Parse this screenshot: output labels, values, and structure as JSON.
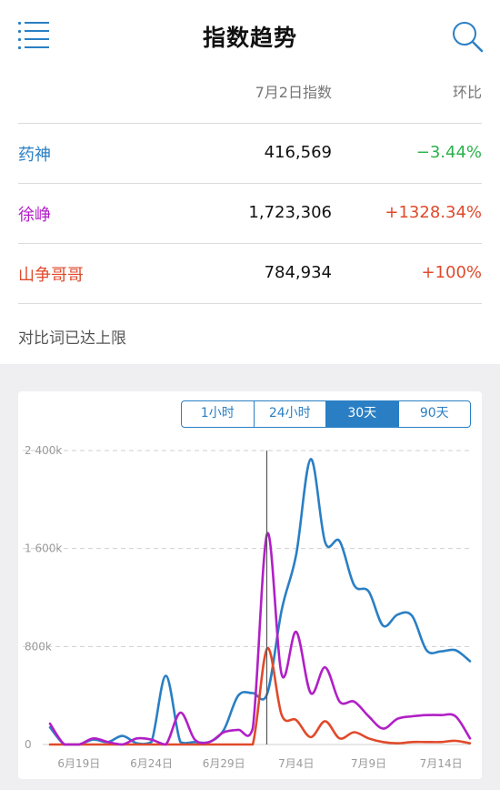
{
  "header": {
    "title": "指数趋势"
  },
  "table": {
    "col_date": "7月2日指数",
    "col_change": "环比",
    "rows": [
      {
        "name": "药神",
        "value": "416,569",
        "change": "−3.44%",
        "name_color": "#2a7fc4",
        "change_color": "#2bb24c"
      },
      {
        "name": "徐峥",
        "value": "1,723,306",
        "change": "+1328.34%",
        "name_color": "#b11fc6",
        "change_color": "#e04a2b"
      },
      {
        "name": "山争哥哥",
        "value": "784,934",
        "change": "+100%",
        "name_color": "#e04a2b",
        "change_color": "#e04a2b"
      }
    ]
  },
  "limit_note": "对比词已达上限",
  "range_tabs": {
    "options": [
      "1小时",
      "24小时",
      "30天",
      "90天"
    ],
    "selected": "30天"
  },
  "chart_data": {
    "type": "line",
    "x": [
      "6月17日",
      "6月18日",
      "6月19日",
      "6月20日",
      "6月21日",
      "6月22日",
      "6月23日",
      "6月24日",
      "6月25日",
      "6月26日",
      "6月27日",
      "6月28日",
      "6月29日",
      "6月30日",
      "7月1日",
      "7月2日",
      "7月3日",
      "7月4日",
      "7月5日",
      "7月6日",
      "7月7日",
      "7月8日",
      "7月9日",
      "7月10日",
      "7月11日",
      "7月12日",
      "7月13日",
      "7月14日",
      "7月15日",
      "7月16日"
    ],
    "x_ticks": [
      "6月19日",
      "6月24日",
      "6月29日",
      "7月4日",
      "7月9日",
      "7月14日"
    ],
    "y_ticks": [
      "0",
      "800k",
      "1 600k",
      "2 400k"
    ],
    "ylim": [
      0,
      2400000
    ],
    "grid": true,
    "marker_x": "7月2日",
    "series": [
      {
        "color": "#2a7fc4",
        "values": [
          140000,
          0,
          0,
          40000,
          20000,
          70000,
          10000,
          20000,
          560000,
          20000,
          20000,
          20000,
          120000,
          400000,
          420000,
          416569,
          1100000,
          1550000,
          2330000,
          1650000,
          1660000,
          1300000,
          1250000,
          970000,
          1060000,
          1050000,
          770000,
          760000,
          770000,
          680000
        ]
      },
      {
        "color": "#b11fc6",
        "values": [
          170000,
          0,
          0,
          50000,
          20000,
          0,
          50000,
          40000,
          0,
          260000,
          40000,
          20000,
          100000,
          120000,
          130000,
          1723306,
          570000,
          920000,
          420000,
          630000,
          350000,
          350000,
          230000,
          130000,
          210000,
          230000,
          240000,
          240000,
          230000,
          50000
        ]
      },
      {
        "color": "#e04a2b",
        "values": [
          0,
          0,
          0,
          0,
          0,
          0,
          0,
          0,
          0,
          0,
          0,
          0,
          0,
          0,
          0,
          784934,
          240000,
          200000,
          60000,
          190000,
          50000,
          100000,
          50000,
          20000,
          10000,
          20000,
          20000,
          20000,
          30000,
          10000
        ]
      }
    ]
  }
}
